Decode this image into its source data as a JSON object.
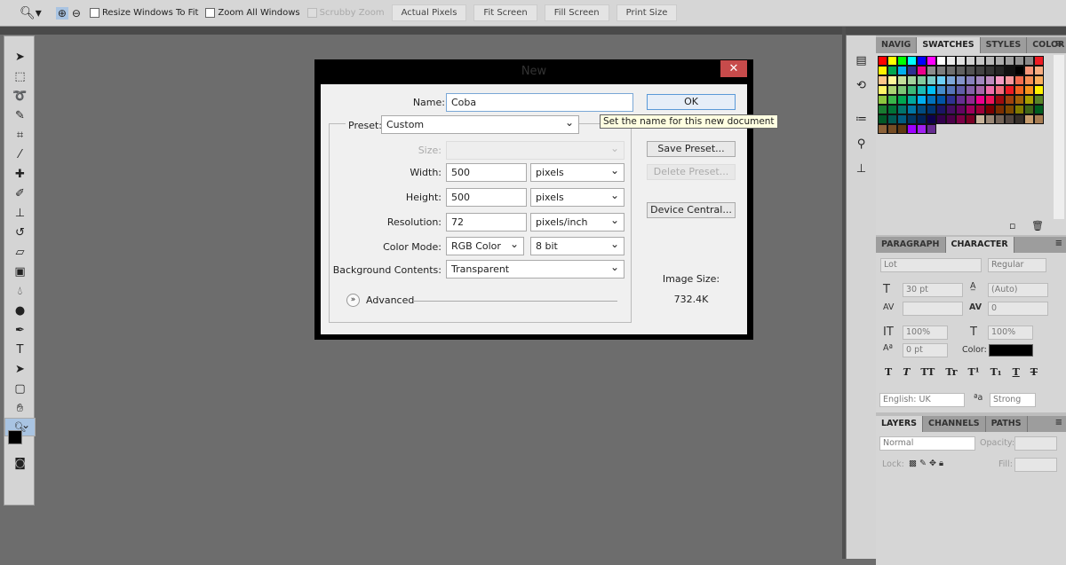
{
  "options_bar": {
    "resize_windows": "Resize Windows To Fit",
    "zoom_all": "Zoom All Windows",
    "scrubby_zoom": "Scrubby Zoom",
    "actual_pixels": "Actual Pixels",
    "fit_screen": "Fit Screen",
    "fill_screen": "Fill Screen",
    "print_size": "Print Size"
  },
  "dialog": {
    "title": "New",
    "name_label": "Name:",
    "name_value": "Coba",
    "preset_label": "Preset:",
    "preset_value": "Custom",
    "size_label": "Size:",
    "width_label": "Width:",
    "width_value": "500",
    "width_unit": "pixels",
    "height_label": "Height:",
    "height_value": "500",
    "height_unit": "pixels",
    "resolution_label": "Resolution:",
    "resolution_value": "72",
    "resolution_unit": "pixels/inch",
    "color_mode_label": "Color Mode:",
    "color_mode_value": "RGB Color",
    "bit_depth": "8 bit",
    "background_label": "Background Contents:",
    "background_value": "Transparent",
    "advanced_label": "Advanced",
    "ok": "OK",
    "save_preset": "Save Preset...",
    "delete_preset": "Delete Preset...",
    "device_central": "Device Central...",
    "image_size_label": "Image Size:",
    "image_size_value": "732.4K",
    "tooltip": "Set the name for this new document"
  },
  "swatches_panel": {
    "tabs": [
      "NAVIG",
      "SWATCHES",
      "STYLES",
      "COLOR"
    ],
    "colors": [
      "#ff0000",
      "#ffff00",
      "#00ff00",
      "#00ffff",
      "#0000ff",
      "#ff00ff",
      "#ffffff",
      "#ebebeb",
      "#e0e0e0",
      "#d2d2d2",
      "#c6c6c6",
      "#b9b9b9",
      "#adadad",
      "#a1a1a1",
      "#959595",
      "#898989",
      "#ed1c24",
      "#fff200",
      "#00a651",
      "#00aeef",
      "#2e3192",
      "#ec008c",
      "#8c8c8c",
      "#7d7d7d",
      "#6e6e6e",
      "#606060",
      "#525252",
      "#434343",
      "#363636",
      "#262626",
      "#111111",
      "#000000",
      "#f7977a",
      "#f9ad81",
      "#fdc68a",
      "#fff79a",
      "#c4df9b",
      "#a3d39c",
      "#82ca9d",
      "#7accc8",
      "#6dcff6",
      "#7da7d9",
      "#8393ca",
      "#8781bd",
      "#a187be",
      "#bd8cbf",
      "#f49ac2",
      "#f6989d",
      "#f26c4f",
      "#f68e55",
      "#fbaf5d",
      "#fff568",
      "#acd373",
      "#7cc576",
      "#3cb878",
      "#1cbbb4",
      "#00bff3",
      "#448ccb",
      "#5574b9",
      "#605ca8",
      "#855fa8",
      "#a864a8",
      "#f06eaa",
      "#f26d7d",
      "#ed1c24",
      "#f26522",
      "#f7941d",
      "#fff200",
      "#8dc63f",
      "#39b54a",
      "#00a651",
      "#00a99d",
      "#00aeef",
      "#0072bc",
      "#0054a6",
      "#2e3192",
      "#662d91",
      "#92278f",
      "#ec008c",
      "#ed145b",
      "#9e0b0f",
      "#a0410d",
      "#a36209",
      "#aba000",
      "#598527",
      "#197b30",
      "#007236",
      "#00746b",
      "#0076a3",
      "#004b80",
      "#003471",
      "#1b1464",
      "#440e62",
      "#630460",
      "#9e005d",
      "#9e0039",
      "#790000",
      "#7b2e00",
      "#7d4900",
      "#827b00",
      "#406618",
      "#005e20",
      "#005826",
      "#005952",
      "#005b7f",
      "#003663",
      "#002157",
      "#0d004c",
      "#32004b",
      "#4b0049",
      "#7b0046",
      "#7a0026",
      "#c7b299",
      "#998675",
      "#736357",
      "#534741",
      "#37302a",
      "#c69c6d",
      "#a67c52",
      "#8c6239",
      "#754c24",
      "#603913",
      "#9e00ff",
      "#a020f0",
      "#662d91"
    ]
  },
  "character_panel": {
    "tabs": [
      "PARAGRAPH",
      "CHARACTER"
    ],
    "font_family": "Lot",
    "font_style": "Regular",
    "size": "30 pt",
    "leading": "(Auto)",
    "tracking": "0",
    "vertical_scale": "100%",
    "horizontal_scale": "100%",
    "baseline_shift": "0 pt",
    "color_label": "Color:",
    "text_color": "#000000",
    "language": "English: UK",
    "antialias": "Strong",
    "style_buttons": [
      "T",
      "T",
      "TT",
      "Tr",
      "T¹",
      "T₁",
      "T",
      "T"
    ]
  },
  "layers_panel": {
    "tabs": [
      "LAYERS",
      "CHANNELS",
      "PATHS"
    ],
    "blend_mode": "Normal",
    "opacity_label": "Opacity:",
    "lock_label": "Lock:",
    "fill_label": "Fill:"
  }
}
